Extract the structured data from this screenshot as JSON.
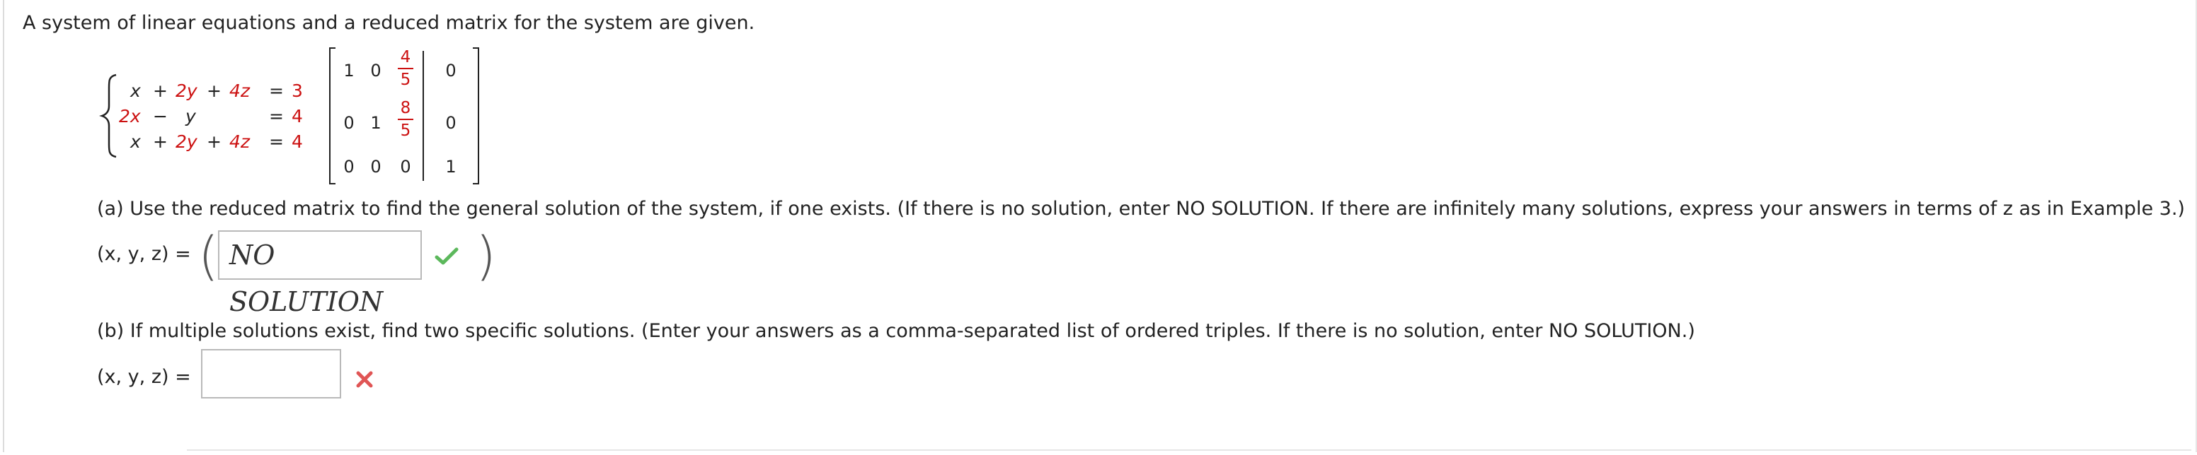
{
  "intro": "A system of linear equations and a reduced matrix for the system are given.",
  "system": {
    "rows": [
      {
        "a": "x",
        "op1": "+",
        "b": "2y",
        "op2": "+",
        "c": "4z",
        "eq": "=",
        "rhs": "3"
      },
      {
        "a": "2x",
        "op1": "−",
        "b": "y",
        "op2": "",
        "c": "",
        "eq": "=",
        "rhs": "4"
      },
      {
        "a": "x",
        "op1": "+",
        "b": "2y",
        "op2": "+",
        "c": "4z",
        "eq": "=",
        "rhs": "4"
      }
    ]
  },
  "matrix": {
    "r1": {
      "c1": "1",
      "c2": "0",
      "num": "4",
      "den": "5",
      "aug": "0"
    },
    "r2": {
      "c1": "0",
      "c2": "1",
      "num": "8",
      "den": "5",
      "aug": "0"
    },
    "r3": {
      "c1": "0",
      "c2": "0",
      "c3": "0",
      "aug": "1"
    }
  },
  "part_a": {
    "prompt": "(a) Use the reduced matrix to find the general solution of the system, if one exists. (If there is no solution, enter NO SOLUTION. If there are infinitely many solutions, express your answers in terms of z as in Example 3.)",
    "label": "(x, y, z) =",
    "answer": "NO SOLUTION",
    "status": "correct",
    "status_color": "#5cb85c"
  },
  "part_b": {
    "prompt": "(b) If multiple solutions exist, find two specific solutions. (Enter your answers as a comma-separated list of ordered triples. If there is no solution, enter NO SOLUTION.)",
    "label": "(x, y, z) =",
    "answer": "",
    "status": "incorrect",
    "status_color": "#e05555"
  }
}
